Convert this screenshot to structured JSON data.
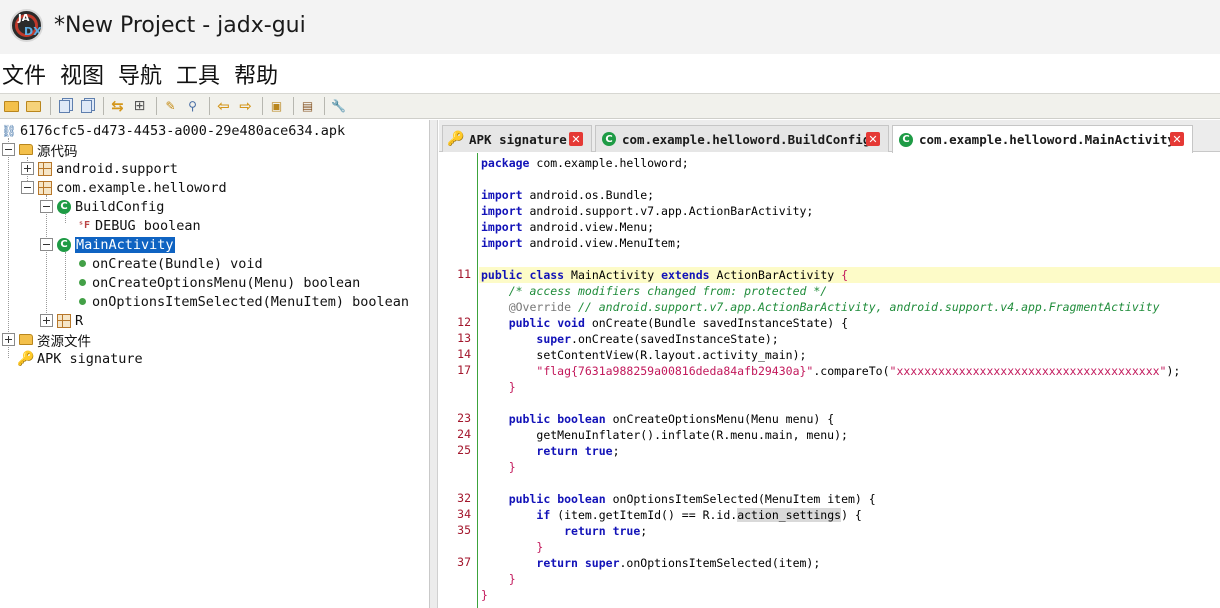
{
  "window": {
    "title": "*New Project - jadx-gui",
    "logo_top": "JA",
    "logo_bottom": "DX"
  },
  "menu": [
    "文件",
    "视图",
    "导航",
    "工具",
    "帮助"
  ],
  "toolbar": {
    "buttons": [
      "open-icon",
      "add-files-icon",
      "sync-icon",
      "save-all-icon",
      "export-icon",
      "flatten-icon",
      "search-icon",
      "find-class-icon",
      "back-icon",
      "forward-icon",
      "deobfuscation-icon",
      "log-icon",
      "preferences-icon"
    ]
  },
  "tree": {
    "root": "6176cfc5-d473-4453-a000-29e480ace634.apk",
    "source": "源代码",
    "pkg_support": "android.support",
    "pkg_main": "com.example.helloword",
    "buildconfig": "BuildConfig",
    "debug_field": "DEBUG boolean",
    "mainactivity": "MainActivity",
    "method1": "onCreate(Bundle) void",
    "method2": "onCreateOptionsMenu(Menu) boolean",
    "method3": "onOptionsItemSelected(MenuItem) boolean",
    "r_class": "R",
    "resources": "资源文件",
    "apk_signature": "APK signature"
  },
  "tabs": [
    {
      "label": "APK signature",
      "icon": "key-icon"
    },
    {
      "label": "com.example.helloword.BuildConfig",
      "icon": "class-icon"
    },
    {
      "label": "com.example.helloword.MainActivity",
      "icon": "class-icon",
      "active": true
    }
  ],
  "code": {
    "line_numbers": [
      "11",
      "12",
      "13",
      "14",
      "17",
      "23",
      "24",
      "25",
      "32",
      "34",
      "35",
      "37"
    ],
    "package_name": "com.example.helloword;",
    "imports": [
      "android.os.Bundle;",
      "android.support.v7.app.ActionBarActivity;",
      "android.view.Menu;",
      "android.view.MenuItem;"
    ],
    "class_decl": {
      "name": "MainActivity",
      "parent": "ActionBarActivity"
    },
    "comment_modifiers": "/* access modifiers changed from: protected */",
    "override": "@Override",
    "override_comment": "// android.support.v7.app.ActionBarActivity, android.support.v4.app.FragmentActivity",
    "oncreate_sig": "onCreate(Bundle savedInstanceState) {",
    "super_oncreate": ".onCreate(savedInstanceState);",
    "set_content": "setContentView(R.layout.activity_main);",
    "flag_string": "\"flag{7631a988259a00816deda84afb29430a}\"",
    "compare_to": ".compareTo(",
    "x_string": "\"xxxxxxxxxxxxxxxxxxxxxxxxxxxxxxxxxxxxxx\"",
    "end_stmt": ");",
    "menu_sig": "onCreateOptionsMenu(Menu menu) {",
    "inflate": "getMenuInflater().inflate(R.menu.main, menu);",
    "item_sig": "onOptionsItemSelected(MenuItem item) {",
    "if_cond_a": "(item.getItemId() == R.id.",
    "if_cond_b": "action_settings",
    "if_cond_c": ") {",
    "super_item": ".onOptionsItemSelected(item);"
  },
  "colors": {
    "selection": "#0f63c2",
    "keyword": "#1212b8",
    "string": "#c2185b",
    "comment": "#1f8c3a",
    "line_number": "#a3162c",
    "highlight_line": "#fdfbc8"
  }
}
